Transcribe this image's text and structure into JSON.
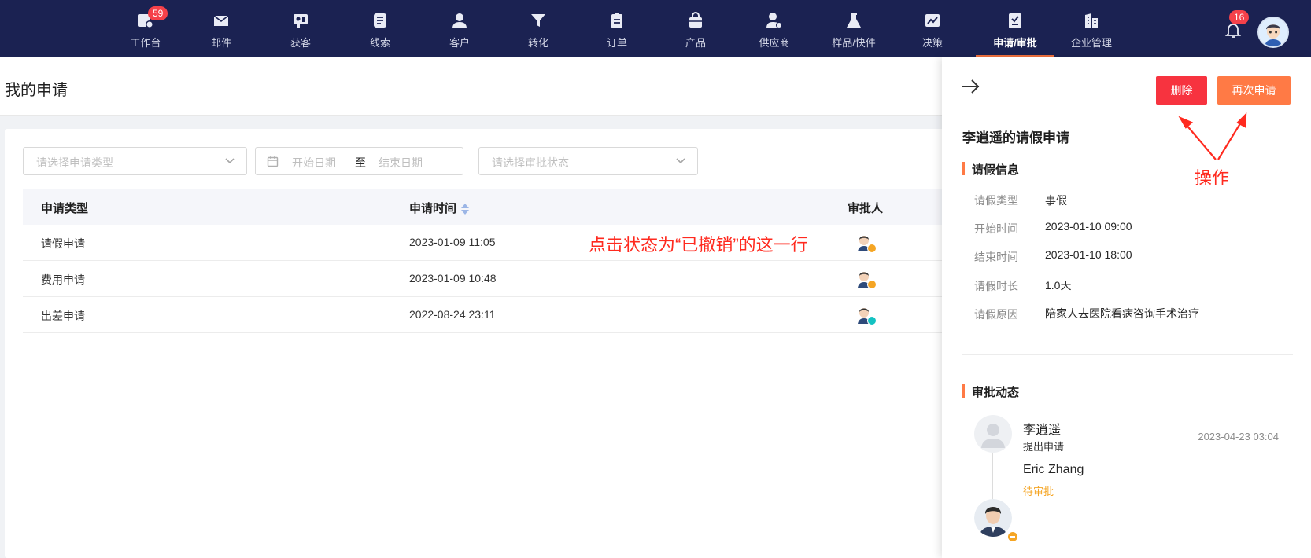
{
  "nav": {
    "items": [
      {
        "label": "工作台",
        "icon": "workbench-icon",
        "badge": "59"
      },
      {
        "label": "邮件",
        "icon": "mail-icon"
      },
      {
        "label": "获客",
        "icon": "acquire-icon"
      },
      {
        "label": "线索",
        "icon": "leads-icon"
      },
      {
        "label": "客户",
        "icon": "customer-icon"
      },
      {
        "label": "转化",
        "icon": "funnel-icon"
      },
      {
        "label": "订单",
        "icon": "order-icon"
      },
      {
        "label": "产品",
        "icon": "product-icon"
      },
      {
        "label": "供应商",
        "icon": "supplier-icon"
      },
      {
        "label": "样品/快件",
        "icon": "sample-icon"
      },
      {
        "label": "决策",
        "icon": "chart-icon"
      },
      {
        "label": "申请/审批",
        "icon": "approval-icon",
        "active": true
      },
      {
        "label": "企业管理",
        "icon": "building-icon"
      }
    ],
    "notification_badge": "16",
    "accent_color": "#f0703e",
    "bg_color": "#1b2252"
  },
  "page": {
    "title": "我的申请"
  },
  "filters": {
    "type_placeholder": "请选择申请类型",
    "date_start": "开始日期",
    "date_sep": "至",
    "date_end": "结束日期",
    "status_placeholder": "请选择审批状态"
  },
  "table": {
    "headers": {
      "type": "申请类型",
      "time": "申请时间",
      "approver": "审批人"
    },
    "rows": [
      {
        "type": "请假申请",
        "time": "2023-01-09 11:05",
        "status_color": "#f5a524"
      },
      {
        "type": "费用申请",
        "time": "2023-01-09 10:48",
        "status_color": "#f5a524"
      },
      {
        "type": "出差申请",
        "time": "2022-08-24 23:11",
        "status_color": "#13c2c2"
      }
    ]
  },
  "annotations": {
    "row_hint": "点击状态为“已撤销”的这一行",
    "action_hint": "操作",
    "color": "#ff2a1f"
  },
  "drawer": {
    "delete_label": "删除",
    "reapply_label": "再次申请",
    "title": "李逍遥的请假申请",
    "info_section": "请假信息",
    "fields": [
      {
        "label": "请假类型",
        "value": "事假"
      },
      {
        "label": "开始时间",
        "value": "2023-01-10 09:00"
      },
      {
        "label": "结束时间",
        "value": "2023-01-10 18:00"
      },
      {
        "label": "请假时长",
        "value": "1.0天"
      },
      {
        "label": "请假原因",
        "value": "陪家人去医院看病咨询手术治疗"
      }
    ],
    "flow_section": "审批动态",
    "timeline": [
      {
        "name": "李逍遥",
        "action": "提出申请",
        "time": "2023-04-23 03:04"
      },
      {
        "name": "Eric Zhang",
        "action": "待审批",
        "action_color": "#f5a524"
      }
    ]
  }
}
